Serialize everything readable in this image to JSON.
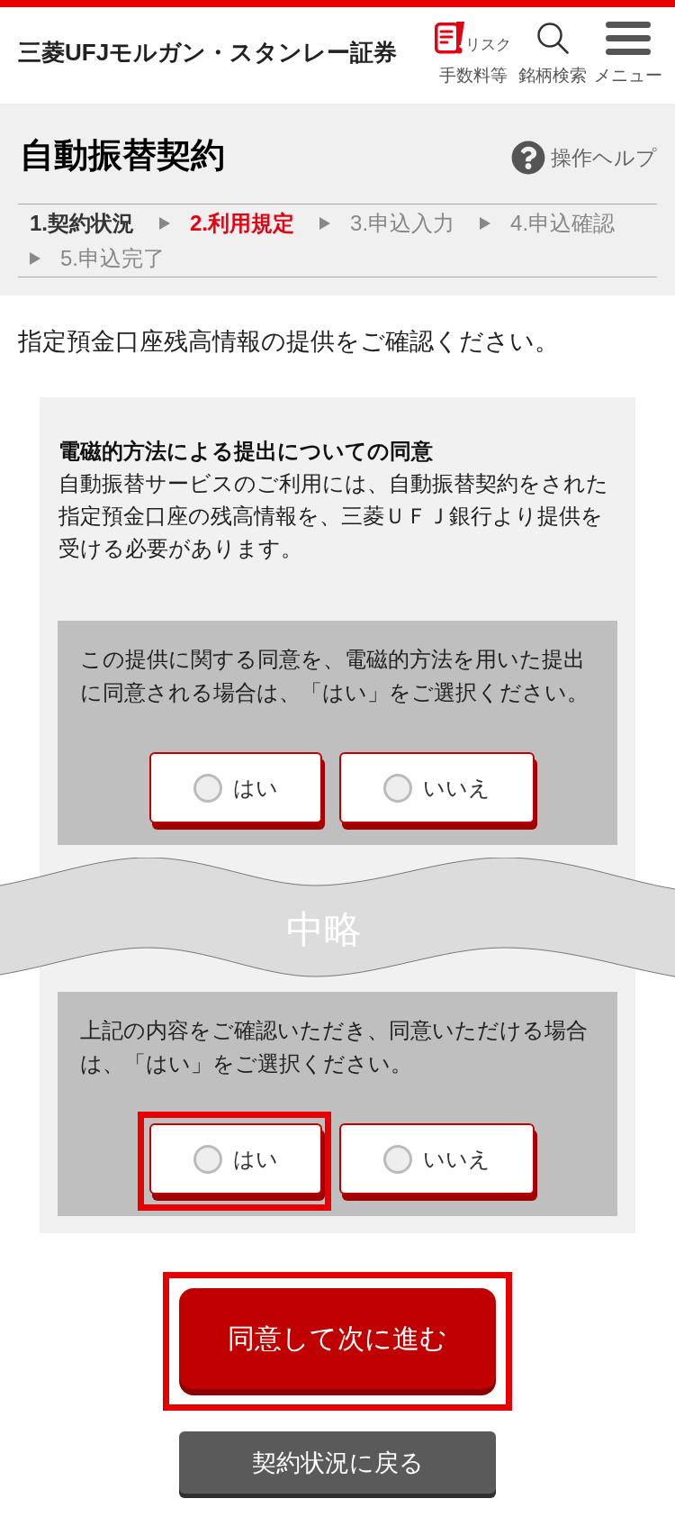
{
  "header": {
    "logo": "三菱UFJモルガン・スタンレー証券",
    "nav": [
      {
        "kind": "risk",
        "caption": "リスク",
        "label": "手数料等"
      },
      {
        "kind": "search",
        "label": "銘柄検索"
      },
      {
        "kind": "menu",
        "label": "メニュー"
      }
    ]
  },
  "page": {
    "title": "自動振替契約",
    "help": "操作ヘルプ"
  },
  "steps": [
    {
      "label": "1.契約状況",
      "completed": true,
      "selected": false
    },
    {
      "label": "2.利用規定",
      "completed": false,
      "selected": true
    },
    {
      "label": "3.申込入力",
      "completed": false,
      "selected": false
    },
    {
      "label": "4.申込確認",
      "completed": false,
      "selected": false
    },
    {
      "label": "5.申込完了",
      "completed": false,
      "selected": false
    }
  ],
  "intro": "指定預金口座残高情報の提供をご確認ください。",
  "card": {
    "blocks": [
      {
        "kind": "consent",
        "heading": "電磁的方法による提出についての同意",
        "body": "自動振替サービスのご利用には、自動振替契約をされた指定預金口座の残高情報を、三菱ＵＦＪ銀行より提供を受ける必要があります。",
        "question": "この提供に関する同意を、電磁的方法を用いた提出に同意される場合は、「はい」をご選択ください。",
        "options": [
          {
            "label": "はい",
            "selected": false,
            "highlighted": false
          },
          {
            "label": "いいえ",
            "selected": false,
            "highlighted": false
          }
        ]
      },
      {
        "kind": "omission",
        "label": "中略"
      },
      {
        "kind": "consent",
        "question": "上記の内容をご確認いただき、同意いただける場合は、「はい」をご選択ください。",
        "options": [
          {
            "label": "はい",
            "selected": false,
            "highlighted": true
          },
          {
            "label": "いいえ",
            "selected": false,
            "highlighted": false
          }
        ]
      }
    ]
  },
  "buttons": [
    {
      "kind": "primary",
      "label": "同意して次に進む",
      "highlighted": true
    },
    {
      "kind": "secondary",
      "label": "契約状況に戻る",
      "highlighted": false
    }
  ]
}
